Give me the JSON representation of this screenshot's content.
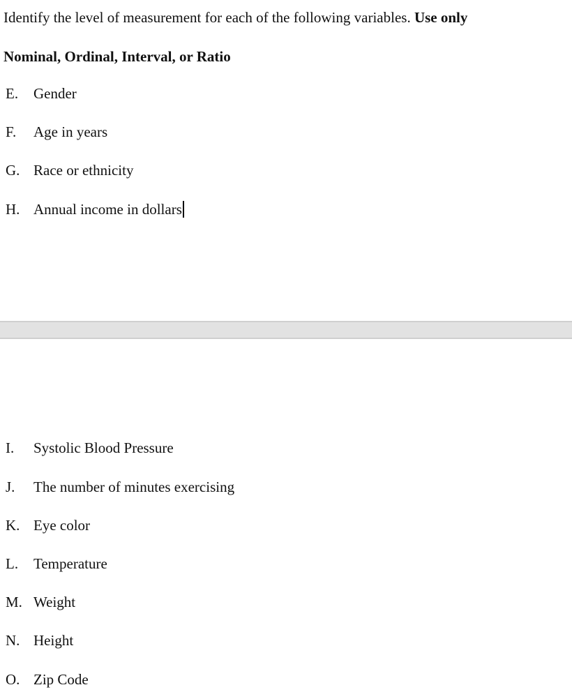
{
  "instructions": {
    "text": "Identify the level of measurement for each of the following variables.",
    "bold_suffix": "Use only",
    "options_line": "Nominal, Ordinal, Interval, or Ratio"
  },
  "items_page1": [
    {
      "letter": "E.",
      "text": "Gender"
    },
    {
      "letter": "F.",
      "text": "Age in years"
    },
    {
      "letter": "G.",
      "text": "Race or ethnicity"
    },
    {
      "letter": "H.",
      "text": "Annual income in dollars"
    }
  ],
  "items_page2": [
    {
      "letter": "I.",
      "text": "Systolic Blood Pressure"
    },
    {
      "letter": "J.",
      "text": "The number of minutes exercising"
    },
    {
      "letter": "K.",
      "text": "Eye color"
    },
    {
      "letter": "L.",
      "text": "Temperature"
    },
    {
      "letter": "M.",
      "text": "Weight"
    },
    {
      "letter": "N.",
      "text": "Height"
    },
    {
      "letter": "O.",
      "text": "Zip Code"
    }
  ]
}
